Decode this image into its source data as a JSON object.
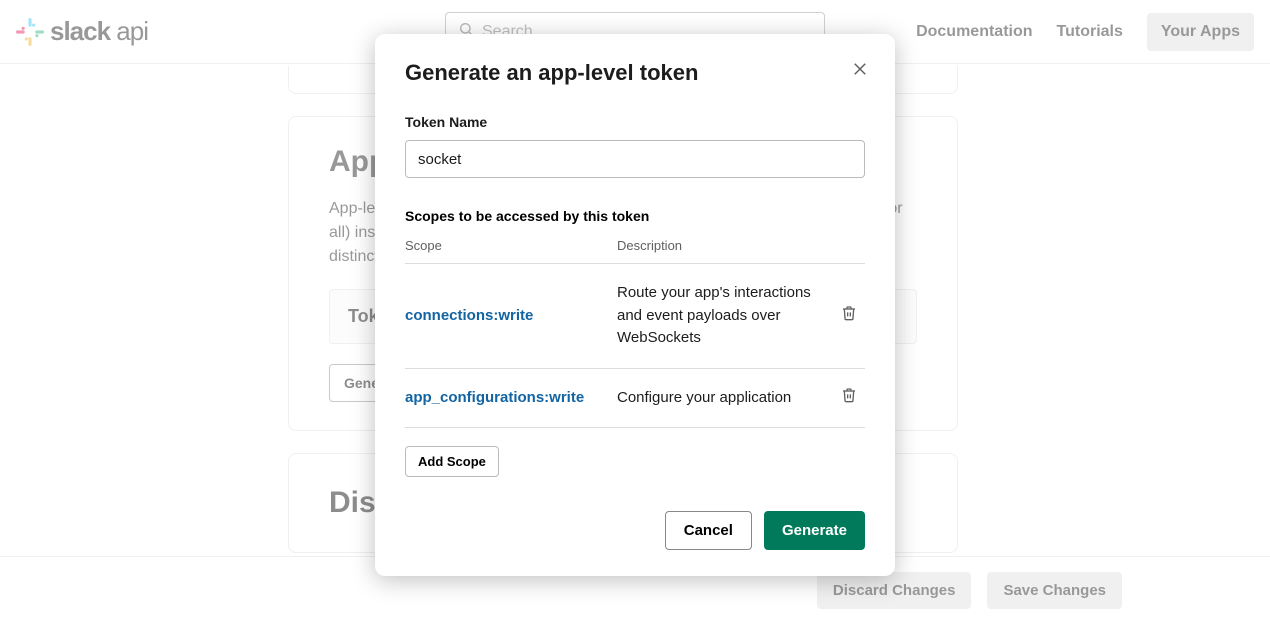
{
  "header": {
    "brand_bold": "slack",
    "brand_light": " api",
    "search_placeholder": "Search",
    "nav": {
      "docs": "Documentation",
      "tutorials": "Tutorials",
      "your_apps": "Your Apps"
    }
  },
  "background": {
    "section_title": "App-",
    "section_text": "App-level tokens allow your app to use platform features that apply to multiple (or all) installations... that is, across every workspace. Your app will only receive the distinct scopes, s... maximum...",
    "token_header": "Token",
    "generate_btn": "Genera",
    "next_section": "Dis",
    "footer_discard": "Discard Changes",
    "footer_save": "Save Changes"
  },
  "modal": {
    "title": "Generate an app-level token",
    "token_name_label": "Token Name",
    "token_name_value": "socket",
    "scopes_title": "Scopes to be accessed by this token",
    "col_scope": "Scope",
    "col_desc": "Description",
    "scopes": [
      {
        "name": "connections:write",
        "desc": "Route your app's interactions and event payloads over WebSockets"
      },
      {
        "name": "app_configurations:write",
        "desc": "Configure your application"
      }
    ],
    "add_scope": "Add Scope",
    "cancel": "Cancel",
    "generate": "Generate"
  }
}
